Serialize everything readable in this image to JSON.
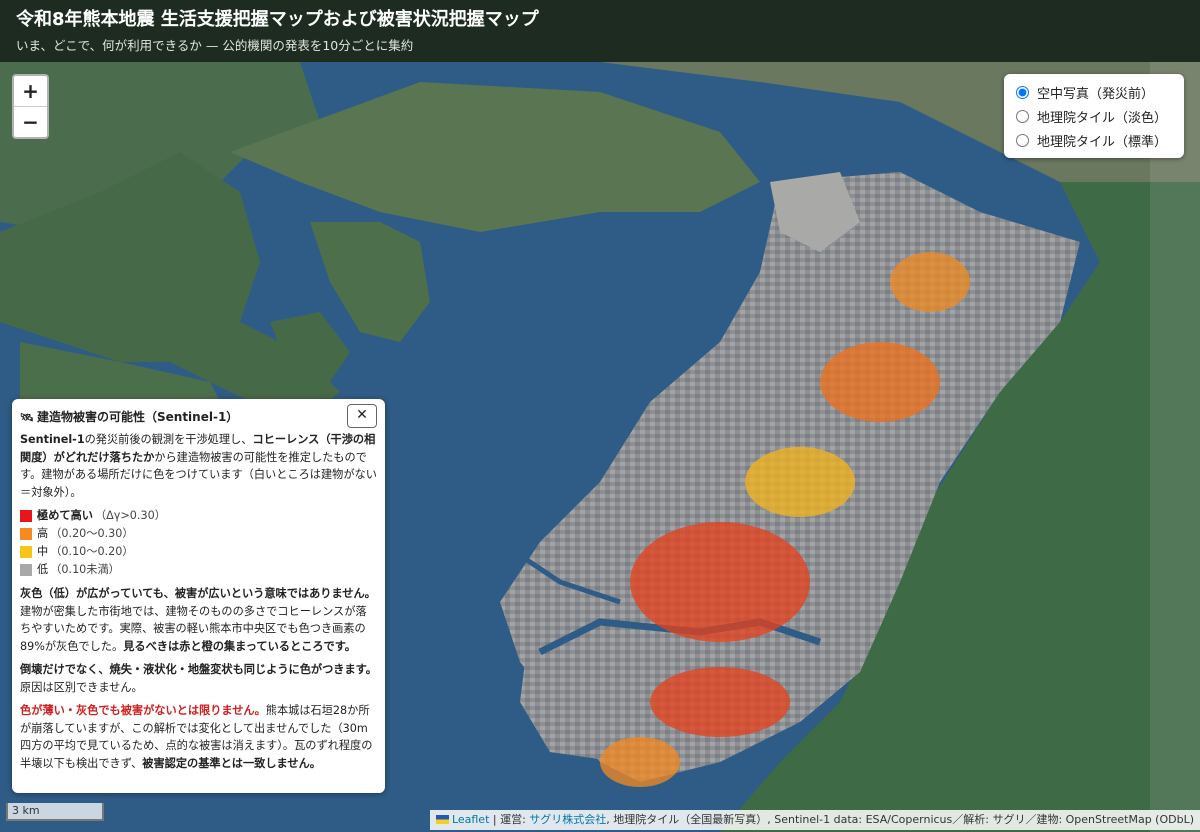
{
  "header": {
    "title": "令和8年熊本地震 生活支援把握マップおよび被害状況把握マップ",
    "subtitle": "いま、どこで、何が利用できるか — 公的機関の発表を10分ごとに集約"
  },
  "zoom": {
    "in_label": "+",
    "out_label": "−"
  },
  "layers": {
    "options": [
      {
        "label": "空中写真（発災前）",
        "selected": true
      },
      {
        "label": "地理院タイル（淡色）",
        "selected": false
      },
      {
        "label": "地理院タイル（標準）",
        "selected": false
      }
    ]
  },
  "legend": {
    "icon": "satellite-icon",
    "title": "建造物被害の可能性（Sentinel-1）",
    "close_label": "✕",
    "intro_b1": "Sentinel-1",
    "intro_t1": "の発災前後の観測を干渉処理し、",
    "intro_b2": "コヒーレンス（干渉の相関度）がどれだけ落ちたか",
    "intro_t2": "から建造物被害の可能性を推定したものです。建物がある場所だけに色をつけています（白いところは建物がない＝対象外）。",
    "items": [
      {
        "label": "極めて高い",
        "range": "（Δγ>0.30）",
        "color": "#e8151a",
        "bold": true
      },
      {
        "label": "高",
        "range": "（0.20〜0.30）",
        "color": "#f6891f",
        "bold": false
      },
      {
        "label": "中",
        "range": "（0.10〜0.20）",
        "color": "#f5c518",
        "bold": false
      },
      {
        "label": "低",
        "range": "（0.10未満）",
        "color": "#a8a8a8",
        "bold": false
      }
    ],
    "p2_b1": "灰色（低）が広がっていても、被害が広いという意味ではありません。",
    "p2_t1": "建物が密集した市街地では、建物そのものの多さでコヒーレンスが落ちやすいためです。実際、被害の軽い熊本市中央区でも色つき画素の89%が灰色でした。",
    "p2_b2": "見るべきは赤と橙の集まっているところです。",
    "p3_b1": "倒壊だけでなく、焼失・液状化・地盤変状も同じように色がつきます。",
    "p3_t1": "原因は区別できません。",
    "p4_red": "色が薄い・灰色でも被害がないとは限りません。",
    "p4_t1": "熊本城は石垣28か所が崩落していますが、この解析では変化として出ませんでした（30m四方の平均で見ているため、点的な被害は消えます）。瓦のずれ程度の半壊以下も検出できず、",
    "p4_b1": "被害認定の基準とは一致しません。"
  },
  "scale": {
    "label": "3 km"
  },
  "attribution": {
    "leaflet": "Leaflet",
    "sep": " | 運営: ",
    "operator": "サグリ株式会社",
    "rest": ", 地理院タイル（全国最新写真）, Sentinel-1 data: ESA/Copernicus／解析: サグリ／建物: OpenStreetMap (ODbL)"
  },
  "colors": {
    "sea": "#2f5c86",
    "land": "#466a48",
    "urban": "#9a9a98",
    "header_bg": "#1e2b21"
  }
}
